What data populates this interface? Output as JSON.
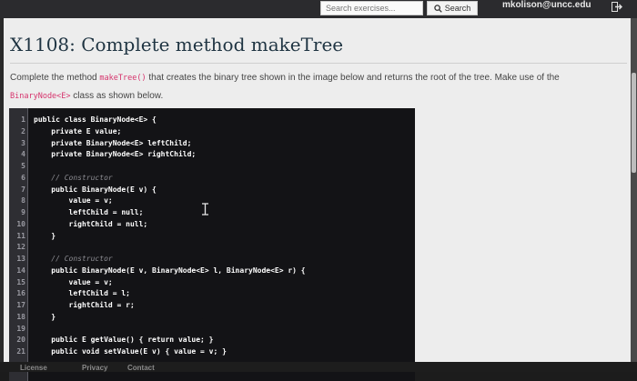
{
  "topbar": {
    "search_placeholder": "Search exercises...",
    "search_button_label": "Search",
    "user_email": "mkolison@uncc.edu"
  },
  "page": {
    "title": "X1108: Complete method makeTree",
    "desc_part1": "Complete the method ",
    "desc_code1": "makeTree()",
    "desc_part2": " that creates the binary tree shown in the image below and returns the root of the tree. Make use of the ",
    "desc_code2": "BinaryNode<E>",
    "desc_part3": " class as shown below."
  },
  "code": {
    "lines": [
      {
        "num": "1",
        "text": "public class BinaryNode<E> {"
      },
      {
        "num": "2",
        "text": "    private E value;"
      },
      {
        "num": "3",
        "text": "    private BinaryNode<E> leftChild;"
      },
      {
        "num": "4",
        "text": "    private BinaryNode<E> rightChild;"
      },
      {
        "num": "5",
        "text": ""
      },
      {
        "num": "6",
        "text": "    // Constructor"
      },
      {
        "num": "7",
        "text": "    public BinaryNode(E v) {"
      },
      {
        "num": "8",
        "text": "        value = v;"
      },
      {
        "num": "9",
        "text": "        leftChild = null;"
      },
      {
        "num": "10",
        "text": "        rightChild = null;"
      },
      {
        "num": "11",
        "text": "    }"
      },
      {
        "num": "12",
        "text": ""
      },
      {
        "num": "13",
        "text": "    // Constructor"
      },
      {
        "num": "14",
        "text": "    public BinaryNode(E v, BinaryNode<E> l, BinaryNode<E> r) {"
      },
      {
        "num": "15",
        "text": "        value = v;"
      },
      {
        "num": "16",
        "text": "        leftChild = l;"
      },
      {
        "num": "17",
        "text": "        rightChild = r;"
      },
      {
        "num": "18",
        "text": "    }"
      },
      {
        "num": "19",
        "text": ""
      },
      {
        "num": "20",
        "text": "    public E getValue() { return value; }"
      },
      {
        "num": "21",
        "text": "    public void setValue(E v) { value = v; }"
      }
    ]
  },
  "footer": {
    "license": "License",
    "privacy": "Privacy",
    "contact": "Contact"
  },
  "icons": {
    "search": "search-icon",
    "logout": "logout-icon",
    "cursor": "text-cursor-icon"
  },
  "colors": {
    "code_bg": "#131316",
    "inline_code": "#d6336c",
    "title": "#1f3442"
  }
}
